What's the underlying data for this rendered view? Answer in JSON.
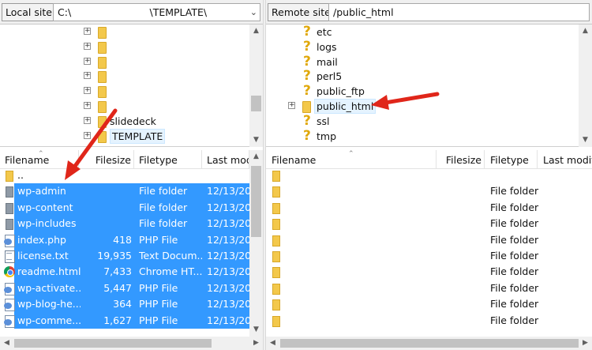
{
  "local": {
    "site_label": "Local site:",
    "path": "C:\\                         \\TEMPLATE\\",
    "tree": [
      {
        "label": "",
        "expander": true,
        "indent": 1
      },
      {
        "label": "",
        "expander": true,
        "indent": 1
      },
      {
        "label": "",
        "expander": true,
        "indent": 1
      },
      {
        "label": "",
        "expander": true,
        "indent": 1
      },
      {
        "label": "",
        "expander": true,
        "indent": 1
      },
      {
        "label": "",
        "expander": true,
        "indent": 1
      },
      {
        "label": "slidedeck",
        "expander": true,
        "indent": 1
      },
      {
        "label": "TEMPLATE",
        "expander": true,
        "indent": 1,
        "selected": true
      }
    ],
    "columns": [
      "Filename",
      "Filesize",
      "Filetype",
      "Last mod"
    ],
    "files": [
      {
        "name": "..",
        "size": "",
        "type": "",
        "date": "",
        "icon": "folder",
        "selected": false
      },
      {
        "name": "wp-admin",
        "size": "",
        "type": "File folder",
        "date": "12/13/20",
        "icon": "folder-grey",
        "selected": true
      },
      {
        "name": "wp-content",
        "size": "",
        "type": "File folder",
        "date": "12/13/20",
        "icon": "folder-grey",
        "selected": true
      },
      {
        "name": "wp-includes",
        "size": "",
        "type": "File folder",
        "date": "12/13/20",
        "icon": "folder-grey",
        "selected": true
      },
      {
        "name": "index.php",
        "size": "418",
        "type": "PHP File",
        "date": "12/13/20",
        "icon": "php",
        "selected": true
      },
      {
        "name": "license.txt",
        "size": "19,935",
        "type": "Text Docum...",
        "date": "12/13/20",
        "icon": "txt",
        "selected": true
      },
      {
        "name": "readme.html",
        "size": "7,433",
        "type": "Chrome HT...",
        "date": "12/13/20",
        "icon": "html",
        "selected": true
      },
      {
        "name": "wp-activate....",
        "size": "5,447",
        "type": "PHP File",
        "date": "12/13/20",
        "icon": "php",
        "selected": true
      },
      {
        "name": "wp-blog-he...",
        "size": "364",
        "type": "PHP File",
        "date": "12/13/20",
        "icon": "php",
        "selected": true
      },
      {
        "name": "wp-comme...",
        "size": "1,627",
        "type": "PHP File",
        "date": "12/13/20",
        "icon": "php",
        "selected": true
      }
    ]
  },
  "remote": {
    "site_label": "Remote site:",
    "path": "/public_html",
    "tree": [
      {
        "label": "etc",
        "icon": "question"
      },
      {
        "label": "logs",
        "icon": "question"
      },
      {
        "label": "mail",
        "icon": "question"
      },
      {
        "label": "perl5",
        "icon": "question"
      },
      {
        "label": "public_ftp",
        "icon": "question"
      },
      {
        "label": "public_html",
        "icon": "folder",
        "expander": true,
        "selected": true
      },
      {
        "label": "ssl",
        "icon": "question"
      },
      {
        "label": "tmp",
        "icon": "question"
      }
    ],
    "columns": [
      "Filename",
      "Filesize",
      "Filetype",
      "Last modifi"
    ],
    "files": [
      {
        "name": "",
        "type": ""
      },
      {
        "name": "",
        "type": "File folder"
      },
      {
        "name": "",
        "type": "File folder"
      },
      {
        "name": "",
        "type": "File folder"
      },
      {
        "name": "",
        "type": "File folder"
      },
      {
        "name": "",
        "type": "File folder"
      },
      {
        "name": "",
        "type": "File folder"
      },
      {
        "name": "",
        "type": "File folder"
      },
      {
        "name": "",
        "type": "File folder"
      },
      {
        "name": "",
        "type": "File folder"
      }
    ]
  },
  "colors": {
    "selection": "#3399ff",
    "annotation_arrow": "#e0261a",
    "folder": "#f3c84b"
  }
}
